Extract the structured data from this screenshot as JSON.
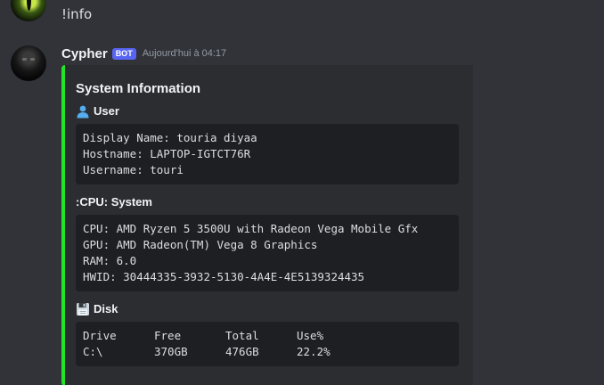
{
  "previous_message": {
    "text": "!info"
  },
  "message": {
    "username": "Cypher",
    "badge": "BOT",
    "timestamp": "Aujourd'hui à 04:17"
  },
  "embed": {
    "accent_color": "#22e52a",
    "title": "System Information",
    "user_field": {
      "icon": "user-icon",
      "name": "User",
      "lines": [
        "Display Name: touria diyaa",
        "Hostname: LAPTOP-IGTCT76R",
        "Username: touri"
      ]
    },
    "system_field": {
      "name": ":CPU: System",
      "lines": [
        "CPU: AMD Ryzen 5 3500U with Radeon Vega Mobile Gfx",
        "GPU: AMD Radeon(TM) Vega 8 Graphics",
        "RAM: 6.0",
        "HWID: 30444335-3932-5130-4A4E-4E5139324435"
      ]
    },
    "disk_field": {
      "icon": "floppy-disk-icon",
      "name": "Disk",
      "headers": [
        "Drive",
        "Free",
        "Total",
        "Use%"
      ],
      "rows": [
        [
          "C:\\",
          "370GB",
          "476GB",
          "22.2%"
        ]
      ]
    }
  }
}
